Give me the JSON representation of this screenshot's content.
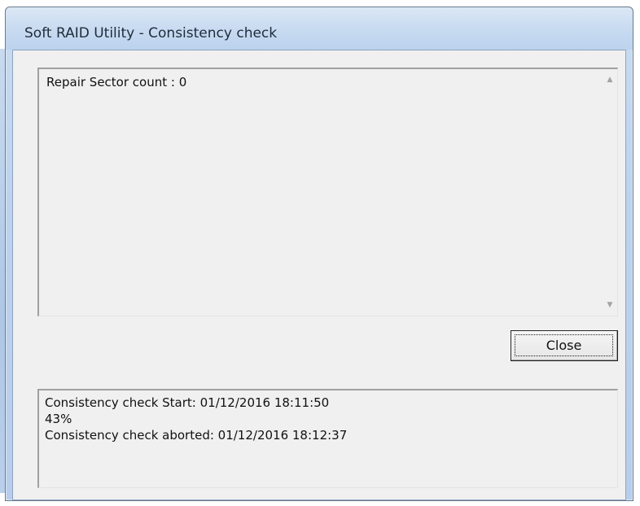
{
  "window": {
    "title": "Soft RAID Utility - Consistency check"
  },
  "sector_panel": {
    "text": "Repair Sector count : 0",
    "scroll_up_glyph": "▲",
    "scroll_down_glyph": "▼"
  },
  "buttons": {
    "close_label": "Close"
  },
  "log": {
    "lines": [
      "Consistency check Start: 01/12/2016 18:11:50",
      "43%",
      "Consistency check aborted: 01/12/2016 18:12:37"
    ]
  },
  "icons": {
    "scroll_up": "scroll-up-arrow-icon",
    "scroll_down": "scroll-down-arrow-icon"
  },
  "colors": {
    "title_bar": "#c7daf0",
    "client_bg": "#f0f0f0",
    "text": "#111111"
  }
}
